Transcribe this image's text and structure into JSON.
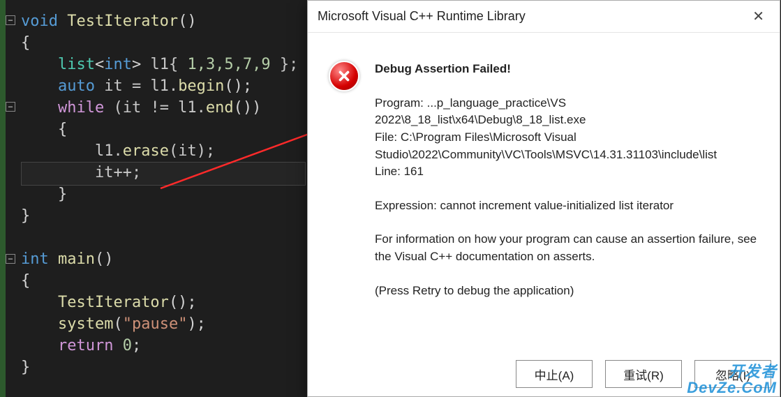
{
  "code": {
    "l1_void": "void",
    "l1_fn": "TestIterator",
    "l1_par": "()",
    "l2": "{",
    "l3_list": "list",
    "l3_lt": "<",
    "l3_int": "int",
    "l3_gt": ">",
    "l3_var": " l1{ ",
    "l3_nums": "1,3,5,7,9",
    "l3_end": " };",
    "l4_auto": "auto",
    "l4_it": " it = l1.",
    "l4_begin": "begin",
    "l4_par": "();",
    "l5_while": "while",
    "l5_open": " (it != l1.",
    "l5_end": "end",
    "l5_close": "())",
    "l6": "{",
    "l7_l1": "l1.",
    "l7_erase": "erase",
    "l7_arg": "(it);",
    "l8_it": "it++;",
    "l9": "}",
    "l10": "}",
    "l12_int": "int",
    "l12_main": "main",
    "l12_par": "()",
    "l13": "{",
    "l14_fn": "TestIterator",
    "l14_par": "();",
    "l15_sys": "system",
    "l15_op": "(",
    "l15_str": "\"pause\"",
    "l15_cl": ");",
    "l16_ret": "return",
    "l16_val": " 0",
    "l16_semi": ";",
    "l17": "}"
  },
  "dialog": {
    "title": "Microsoft Visual C++ Runtime Library",
    "heading": "Debug Assertion Failed!",
    "program": "Program: ...p_language_practice\\VS 2022\\8_18_list\\x64\\Debug\\8_18_list.exe",
    "file": "File: C:\\Program Files\\Microsoft Visual Studio\\2022\\Community\\VC\\Tools\\MSVC\\14.31.31103\\include\\list",
    "line": "Line: 161",
    "expression": "Expression: cannot increment value-initialized list iterator",
    "info": "For information on how your program can cause an assertion failure, see the Visual C++ documentation on asserts.",
    "retry_hint": "(Press Retry to debug the application)",
    "btn_abort": "中止(A)",
    "btn_retry": "重试(R)",
    "btn_ignore": "忽略(I)"
  },
  "watermark": {
    "line1": "开发者",
    "line2": "DevZe.CoM"
  }
}
